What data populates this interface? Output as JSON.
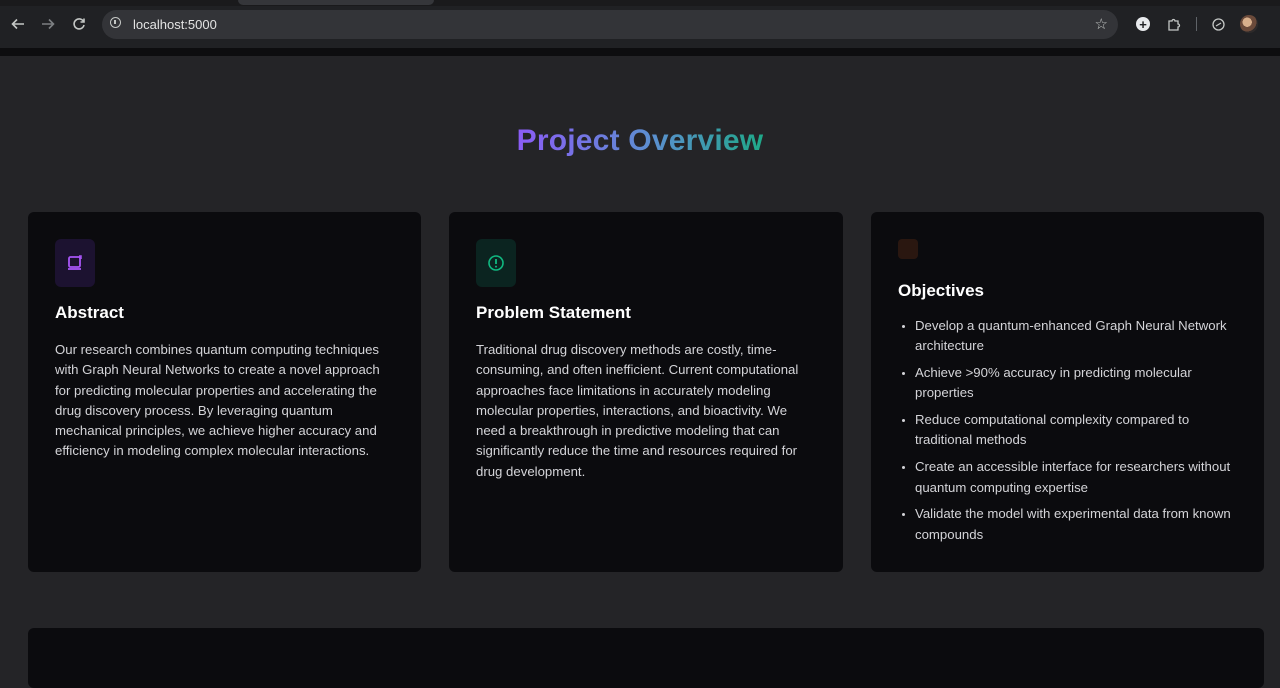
{
  "browser": {
    "url": "localhost:5000",
    "icons": [
      "back-icon",
      "forward-icon",
      "reload-icon",
      "site-info-icon",
      "bookmark-star-icon",
      "extension-add-icon",
      "extensions-puzzle-icon",
      "sync-icon",
      "profile-avatar"
    ]
  },
  "page": {
    "title": "Project Overview",
    "title_gradient": [
      "#8b5cf6",
      "#5b8fd0",
      "#1fa889"
    ]
  },
  "cards": {
    "abstract": {
      "title": "Abstract",
      "icon": "scroll-icon",
      "accent": "#a855f7",
      "text": "Our research combines quantum computing techniques with Graph Neural Networks to create a novel approach for predicting molecular properties and accelerating the drug discovery process. By leveraging quantum mechanical principles, we achieve higher accuracy and efficiency in modeling complex molecular interactions."
    },
    "problem": {
      "title": "Problem Statement",
      "icon": "alert-circle-icon",
      "accent": "#10b981",
      "text": "Traditional drug discovery methods are costly, time-consuming, and often inefficient. Current computational approaches face limitations in accurately modeling molecular properties, interactions, and bioactivity. We need a breakthrough in predictive modeling that can significantly reduce the time and resources required for drug development."
    },
    "objectives": {
      "title": "Objectives",
      "icon": "target-icon",
      "accent": "#f97316",
      "items": [
        "Develop a quantum-enhanced Graph Neural Network architecture",
        "Achieve >90% accuracy in predicting molecular properties",
        "Reduce computational complexity compared to traditional methods",
        "Create an accessible interface for researchers without quantum computing expertise",
        "Validate the model with experimental data from known compounds"
      ]
    }
  }
}
